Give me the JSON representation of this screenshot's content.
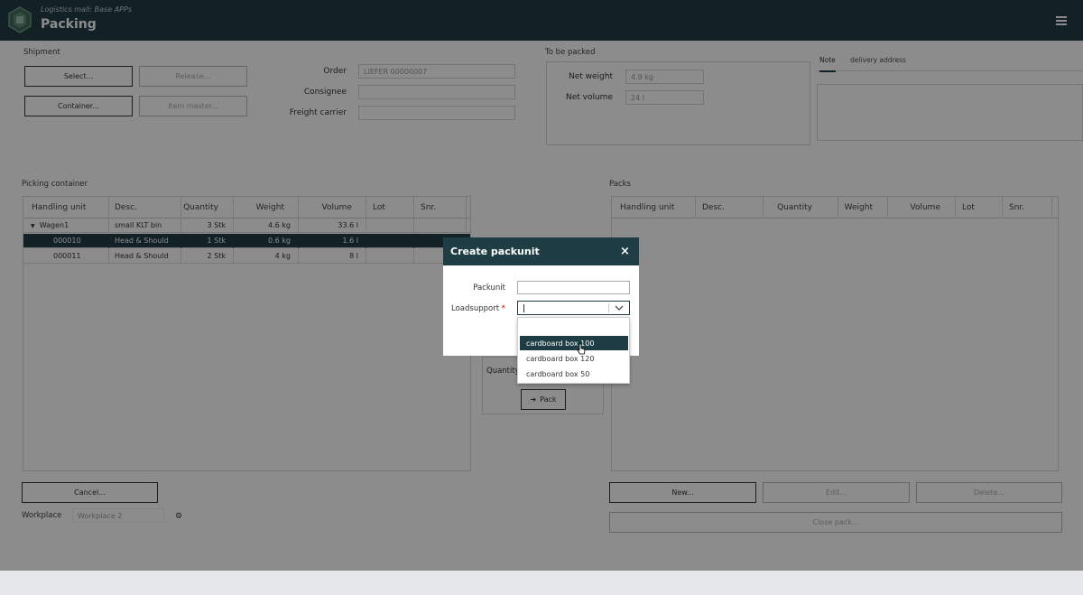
{
  "header": {
    "subtitle": "Logistics mall: Base APPs",
    "title": "Packing"
  },
  "shipment": {
    "label": "Shipment",
    "buttons": {
      "select": "Select...",
      "release": "Release...",
      "container": "Container...",
      "item_master": "Item master..."
    },
    "order_label": "Order",
    "order_value": "LIEFER 00000007",
    "consignee_label": "Consignee",
    "consignee_value": "",
    "freight_label": "Freight carrier",
    "freight_value": ""
  },
  "to_be_packed": {
    "label": "To be packed",
    "net_weight_label": "Net weight",
    "net_weight_value": "4.9 kg",
    "net_volume_label": "Net volume",
    "net_volume_value": "24 l"
  },
  "tabs": {
    "note": "Note",
    "delivery_address": "delivery address"
  },
  "picking": {
    "label": "Picking container",
    "columns": [
      "Handling unit",
      "Desc.",
      "Quantity",
      "Weight",
      "Volume",
      "Lot",
      "Snr."
    ],
    "rows": [
      {
        "hu": "Wagen1",
        "desc": "small KLT bin",
        "qty": "3 Stk",
        "weight": "4.6 kg",
        "volume": "33.6 l",
        "lot": "",
        "snr": ""
      },
      {
        "hu": "000010",
        "desc": "Head & Should",
        "qty": "1 Stk",
        "weight": "0.6 kg",
        "volume": "1.6 l",
        "lot": "",
        "snr": ""
      },
      {
        "hu": "000011",
        "desc": "Head & Should",
        "qty": "2 Stk",
        "weight": "4 kg",
        "volume": "8 l",
        "lot": "",
        "snr": ""
      }
    ],
    "cancel": "Cancel...",
    "workplace_label": "Workplace",
    "workplace_value": "Workplace 2"
  },
  "middle": {
    "quantity_label": "Quantity",
    "pack_button": "Pack"
  },
  "packs": {
    "label": "Packs",
    "columns": [
      "Handling unit",
      "Desc.",
      "Quantity",
      "Weight",
      "Volume",
      "Lot",
      "Snr."
    ],
    "new": "New...",
    "edit": "Edit...",
    "delete": "Delete...",
    "close_pack": "Close pack..."
  },
  "modal": {
    "title": "Create packunit",
    "close_glyph": "×",
    "packunit_label": "Packunit",
    "packunit_value": "",
    "loadsupport_label": "Loadsupport",
    "required_mark": "*",
    "options": [
      "cardboard box 100",
      "cardboard box 120",
      "cardboard box 50"
    ],
    "highlighted_option": "cardboard box 100"
  },
  "colors": {
    "primary": "#1f3d44",
    "overlay": "rgba(0,0,0,0.45)",
    "required": "#cc0000"
  }
}
